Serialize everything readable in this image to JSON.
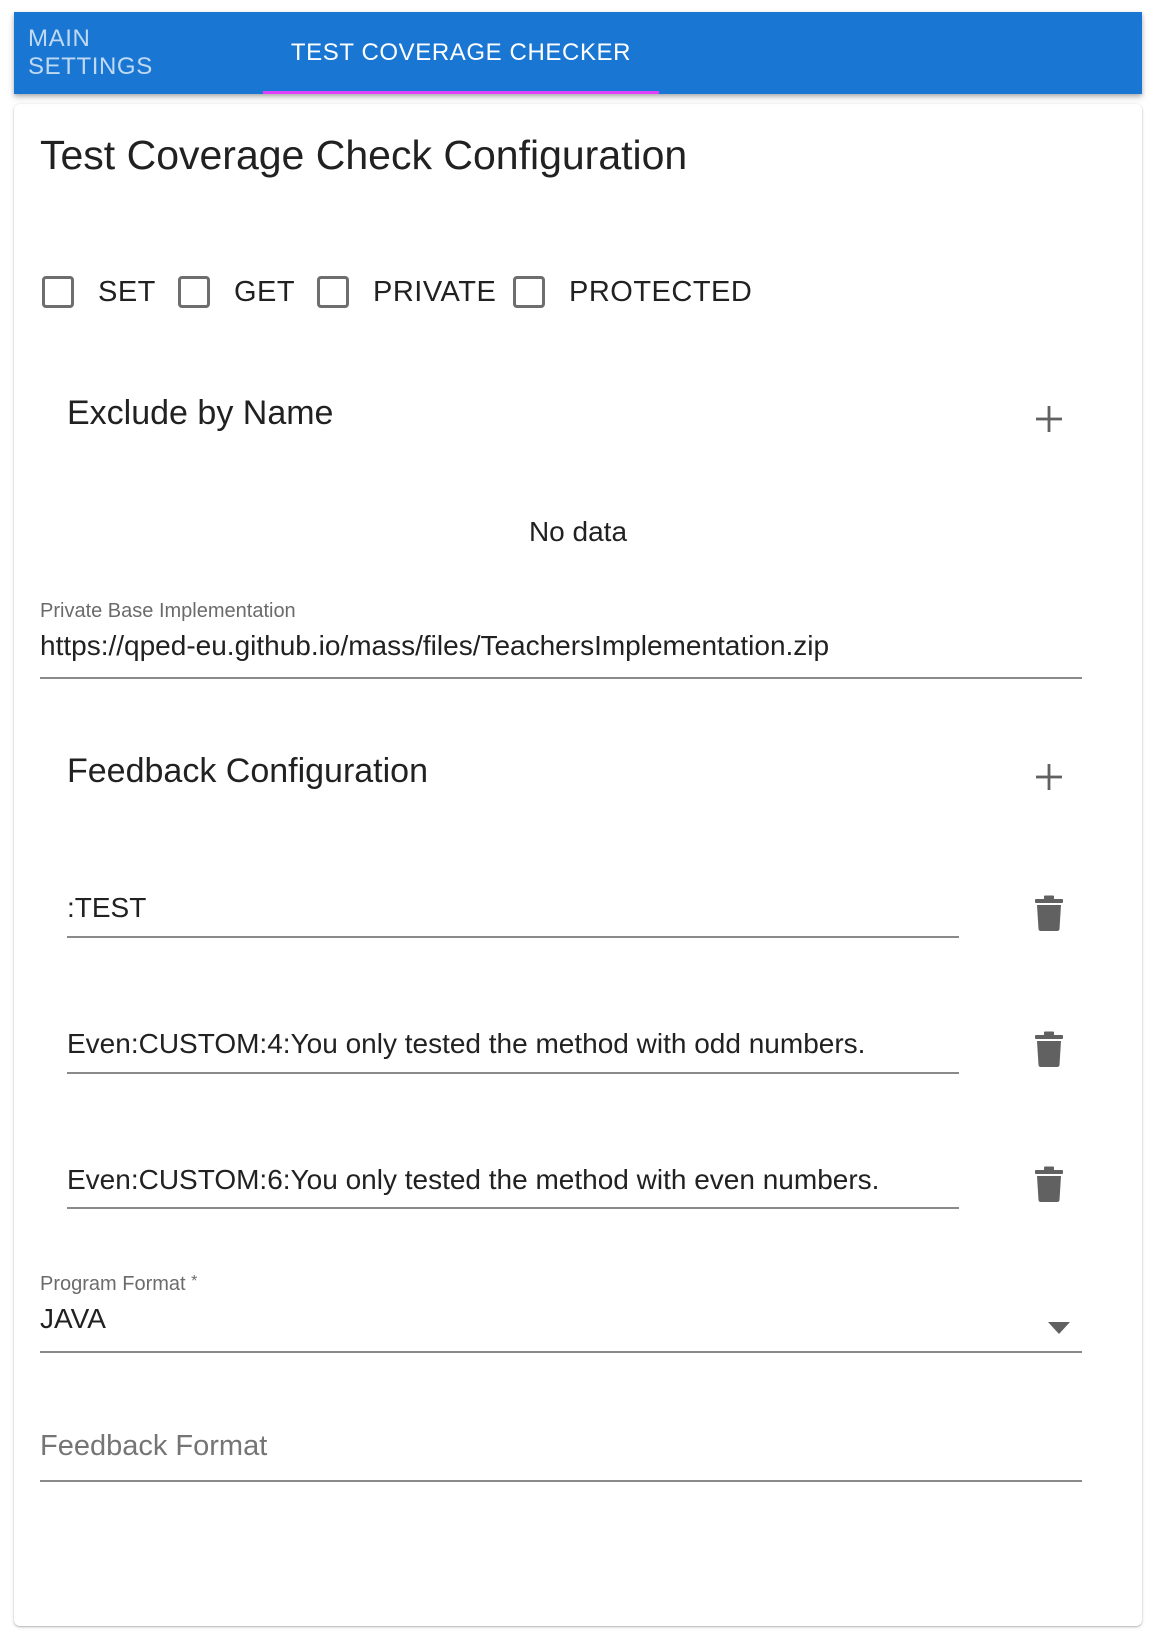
{
  "tabs": [
    {
      "label": "MAIN SETTINGS",
      "active": false
    },
    {
      "label": "TEST COVERAGE CHECKER",
      "active": true
    }
  ],
  "colors": {
    "appbar": "#1976d2",
    "tab_indicator": "#e040fb"
  },
  "card": {
    "title": "Test Coverage Check Configuration",
    "checkboxes": [
      {
        "label": "SET",
        "checked": false
      },
      {
        "label": "GET",
        "checked": false
      },
      {
        "label": "PRIVATE",
        "checked": false
      },
      {
        "label": "PROTECTED",
        "checked": false
      }
    ],
    "exclude_by_name": {
      "title": "Exclude by Name",
      "add_icon": "plus-icon",
      "empty_text": "No data"
    },
    "private_base": {
      "label": "Private Base Implementation",
      "value": "https://qped-eu.github.io/mass/files/TeachersImplementation.zip"
    },
    "feedback_config": {
      "title": "Feedback Configuration",
      "add_icon": "plus-icon",
      "delete_icon": "trash-icon",
      "items": [
        ":TEST",
        "Even:CUSTOM:4:You only tested the method with odd numbers.",
        "Even:CUSTOM:6:You only tested the method with even numbers."
      ]
    },
    "program_format": {
      "label": "Program Format",
      "required_mark": "*",
      "value": "JAVA",
      "dropdown_icon": "caret-down-icon"
    },
    "feedback_format": {
      "placeholder": "Feedback Format"
    }
  }
}
